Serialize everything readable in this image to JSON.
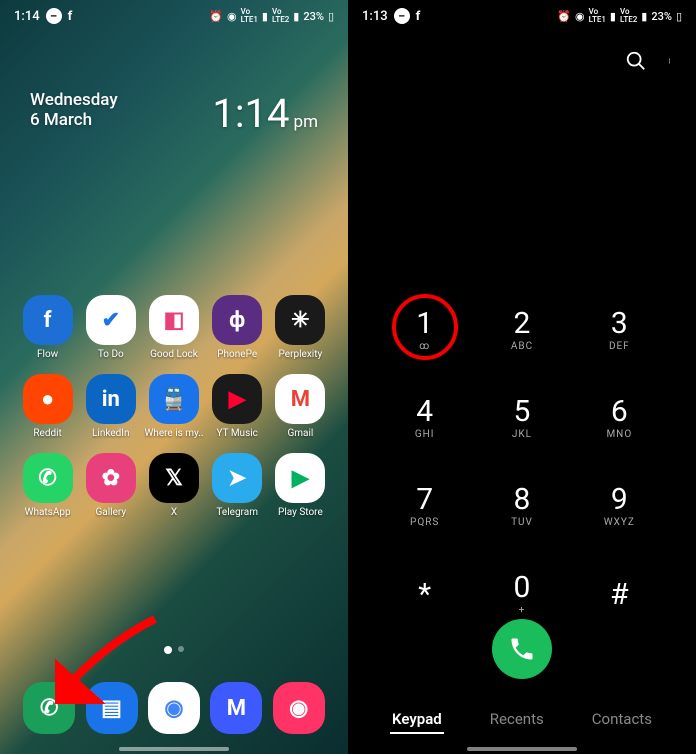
{
  "left": {
    "status": {
      "time": "1:14",
      "battery": "23%",
      "lte1": "LTE1",
      "lte2": "LTE2",
      "vo": "Vo"
    },
    "date_day": "Wednesday",
    "date_num": "6 March",
    "clock_time": "1:14",
    "clock_suffix": "pm",
    "apps": [
      {
        "label": "Flow",
        "bg": "#1d6fd6",
        "glyph": "f",
        "fg": "#fff"
      },
      {
        "label": "To Do",
        "bg": "#ffffff",
        "glyph": "✔",
        "fg": "#1a73e8"
      },
      {
        "label": "Good Lock",
        "bg": "#ffffff",
        "glyph": "◧",
        "fg": "#e8407a"
      },
      {
        "label": "PhonePe",
        "bg": "#5a2d82",
        "glyph": "ф",
        "fg": "#fff"
      },
      {
        "label": "Perplexity",
        "bg": "#1a1a1a",
        "glyph": "✳",
        "fg": "#fff"
      },
      {
        "label": "Reddit",
        "bg": "#ff4500",
        "glyph": "●",
        "fg": "#fff"
      },
      {
        "label": "LinkedIn",
        "bg": "#0a66c2",
        "glyph": "in",
        "fg": "#fff"
      },
      {
        "label": "Where is my..",
        "bg": "#1a73e8",
        "glyph": "🚆",
        "fg": "#fff"
      },
      {
        "label": "YT Music",
        "bg": "#1a1a1a",
        "glyph": "▶",
        "fg": "#ff0033"
      },
      {
        "label": "Gmail",
        "bg": "#ffffff",
        "glyph": "M",
        "fg": "#ea4335"
      },
      {
        "label": "WhatsApp",
        "bg": "#25d366",
        "glyph": "✆",
        "fg": "#fff"
      },
      {
        "label": "Gallery",
        "bg": "#e8407a",
        "glyph": "✿",
        "fg": "#fff"
      },
      {
        "label": "X",
        "bg": "#000000",
        "glyph": "𝕏",
        "fg": "#fff"
      },
      {
        "label": "Telegram",
        "bg": "#2aabee",
        "glyph": "➤",
        "fg": "#fff"
      },
      {
        "label": "Play Store",
        "bg": "#ffffff",
        "glyph": "▶",
        "fg": "#00b160"
      }
    ],
    "dock": [
      {
        "name": "phone",
        "bg": "#1a9e5a",
        "glyph": "✆",
        "fg": "#fff"
      },
      {
        "name": "messages",
        "bg": "#1a73e8",
        "glyph": "▤",
        "fg": "#fff"
      },
      {
        "name": "chrome",
        "bg": "#ffffff",
        "glyph": "◉",
        "fg": "#4285f4"
      },
      {
        "name": "moj",
        "bg": "#3d5afe",
        "glyph": "M",
        "fg": "#fff"
      },
      {
        "name": "camera",
        "bg": "#ff3366",
        "glyph": "◉",
        "fg": "#fff"
      }
    ]
  },
  "right": {
    "status": {
      "time": "1:13",
      "battery": "23%"
    },
    "keys": [
      {
        "num": "1",
        "sub": "ꝏ",
        "highlighted": true
      },
      {
        "num": "2",
        "sub": "ABC"
      },
      {
        "num": "3",
        "sub": "DEF"
      },
      {
        "num": "4",
        "sub": "GHI"
      },
      {
        "num": "5",
        "sub": "JKL"
      },
      {
        "num": "6",
        "sub": "MNO"
      },
      {
        "num": "7",
        "sub": "PQRS"
      },
      {
        "num": "8",
        "sub": "TUV"
      },
      {
        "num": "9",
        "sub": "WXYZ"
      },
      {
        "num": "*",
        "sub": ""
      },
      {
        "num": "0",
        "sub": "+"
      },
      {
        "num": "#",
        "sub": ""
      }
    ],
    "tabs": [
      {
        "label": "Keypad",
        "active": true
      },
      {
        "label": "Recents",
        "active": false
      },
      {
        "label": "Contacts",
        "active": false
      }
    ]
  }
}
